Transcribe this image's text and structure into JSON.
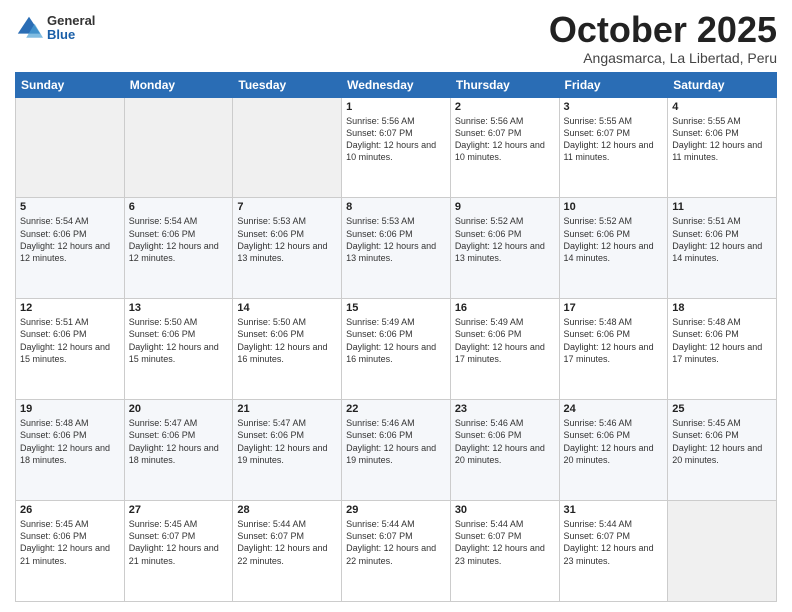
{
  "header": {
    "logo": {
      "general": "General",
      "blue": "Blue"
    },
    "title": "October 2025",
    "location": "Angasmarca, La Libertad, Peru"
  },
  "days_of_week": [
    "Sunday",
    "Monday",
    "Tuesday",
    "Wednesday",
    "Thursday",
    "Friday",
    "Saturday"
  ],
  "weeks": [
    [
      {
        "day": "",
        "empty": true
      },
      {
        "day": "",
        "empty": true
      },
      {
        "day": "",
        "empty": true
      },
      {
        "day": "1",
        "sunrise": "5:56 AM",
        "sunset": "6:07 PM",
        "daylight": "12 hours and 10 minutes."
      },
      {
        "day": "2",
        "sunrise": "5:56 AM",
        "sunset": "6:07 PM",
        "daylight": "12 hours and 10 minutes."
      },
      {
        "day": "3",
        "sunrise": "5:55 AM",
        "sunset": "6:07 PM",
        "daylight": "12 hours and 11 minutes."
      },
      {
        "day": "4",
        "sunrise": "5:55 AM",
        "sunset": "6:06 PM",
        "daylight": "12 hours and 11 minutes."
      }
    ],
    [
      {
        "day": "5",
        "sunrise": "5:54 AM",
        "sunset": "6:06 PM",
        "daylight": "12 hours and 12 minutes."
      },
      {
        "day": "6",
        "sunrise": "5:54 AM",
        "sunset": "6:06 PM",
        "daylight": "12 hours and 12 minutes."
      },
      {
        "day": "7",
        "sunrise": "5:53 AM",
        "sunset": "6:06 PM",
        "daylight": "12 hours and 13 minutes."
      },
      {
        "day": "8",
        "sunrise": "5:53 AM",
        "sunset": "6:06 PM",
        "daylight": "12 hours and 13 minutes."
      },
      {
        "day": "9",
        "sunrise": "5:52 AM",
        "sunset": "6:06 PM",
        "daylight": "12 hours and 13 minutes."
      },
      {
        "day": "10",
        "sunrise": "5:52 AM",
        "sunset": "6:06 PM",
        "daylight": "12 hours and 14 minutes."
      },
      {
        "day": "11",
        "sunrise": "5:51 AM",
        "sunset": "6:06 PM",
        "daylight": "12 hours and 14 minutes."
      }
    ],
    [
      {
        "day": "12",
        "sunrise": "5:51 AM",
        "sunset": "6:06 PM",
        "daylight": "12 hours and 15 minutes."
      },
      {
        "day": "13",
        "sunrise": "5:50 AM",
        "sunset": "6:06 PM",
        "daylight": "12 hours and 15 minutes."
      },
      {
        "day": "14",
        "sunrise": "5:50 AM",
        "sunset": "6:06 PM",
        "daylight": "12 hours and 16 minutes."
      },
      {
        "day": "15",
        "sunrise": "5:49 AM",
        "sunset": "6:06 PM",
        "daylight": "12 hours and 16 minutes."
      },
      {
        "day": "16",
        "sunrise": "5:49 AM",
        "sunset": "6:06 PM",
        "daylight": "12 hours and 17 minutes."
      },
      {
        "day": "17",
        "sunrise": "5:48 AM",
        "sunset": "6:06 PM",
        "daylight": "12 hours and 17 minutes."
      },
      {
        "day": "18",
        "sunrise": "5:48 AM",
        "sunset": "6:06 PM",
        "daylight": "12 hours and 17 minutes."
      }
    ],
    [
      {
        "day": "19",
        "sunrise": "5:48 AM",
        "sunset": "6:06 PM",
        "daylight": "12 hours and 18 minutes."
      },
      {
        "day": "20",
        "sunrise": "5:47 AM",
        "sunset": "6:06 PM",
        "daylight": "12 hours and 18 minutes."
      },
      {
        "day": "21",
        "sunrise": "5:47 AM",
        "sunset": "6:06 PM",
        "daylight": "12 hours and 19 minutes."
      },
      {
        "day": "22",
        "sunrise": "5:46 AM",
        "sunset": "6:06 PM",
        "daylight": "12 hours and 19 minutes."
      },
      {
        "day": "23",
        "sunrise": "5:46 AM",
        "sunset": "6:06 PM",
        "daylight": "12 hours and 20 minutes."
      },
      {
        "day": "24",
        "sunrise": "5:46 AM",
        "sunset": "6:06 PM",
        "daylight": "12 hours and 20 minutes."
      },
      {
        "day": "25",
        "sunrise": "5:45 AM",
        "sunset": "6:06 PM",
        "daylight": "12 hours and 20 minutes."
      }
    ],
    [
      {
        "day": "26",
        "sunrise": "5:45 AM",
        "sunset": "6:06 PM",
        "daylight": "12 hours and 21 minutes."
      },
      {
        "day": "27",
        "sunrise": "5:45 AM",
        "sunset": "6:07 PM",
        "daylight": "12 hours and 21 minutes."
      },
      {
        "day": "28",
        "sunrise": "5:44 AM",
        "sunset": "6:07 PM",
        "daylight": "12 hours and 22 minutes."
      },
      {
        "day": "29",
        "sunrise": "5:44 AM",
        "sunset": "6:07 PM",
        "daylight": "12 hours and 22 minutes."
      },
      {
        "day": "30",
        "sunrise": "5:44 AM",
        "sunset": "6:07 PM",
        "daylight": "12 hours and 23 minutes."
      },
      {
        "day": "31",
        "sunrise": "5:44 AM",
        "sunset": "6:07 PM",
        "daylight": "12 hours and 23 minutes."
      },
      {
        "day": "",
        "empty": true
      }
    ]
  ]
}
